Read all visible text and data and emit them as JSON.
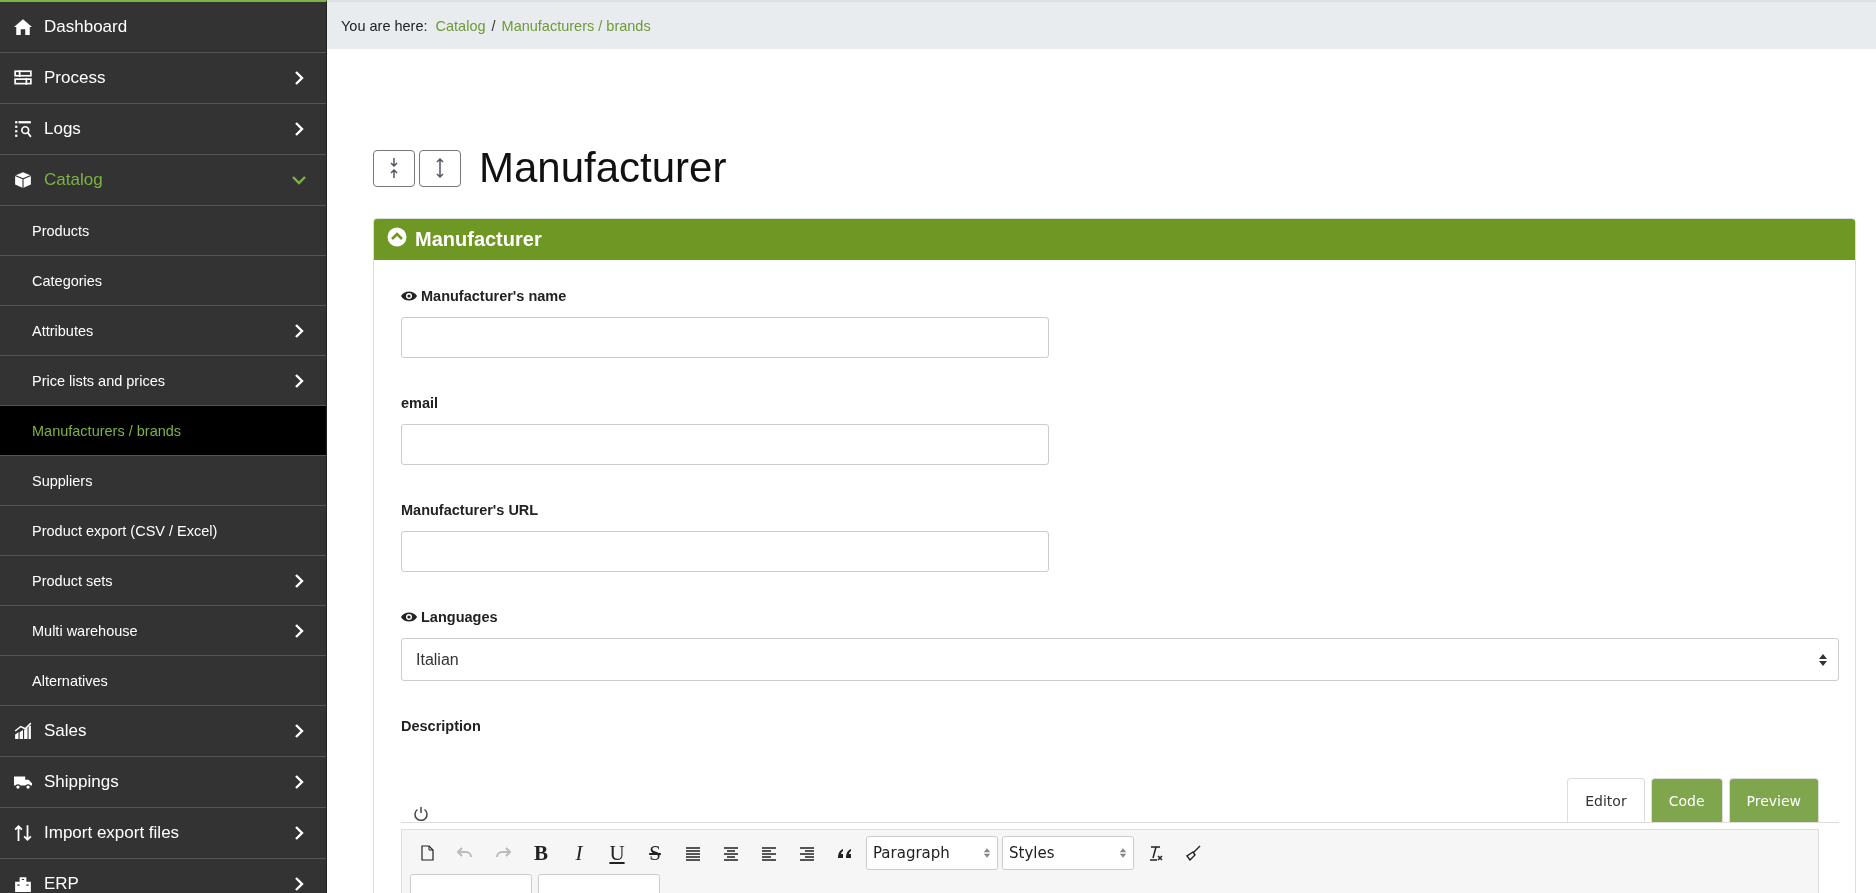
{
  "sidebar": {
    "items": [
      {
        "label": "Dashboard",
        "expandable": false,
        "selected": false
      },
      {
        "label": "Process",
        "expandable": true,
        "expanded": false,
        "selected": false
      },
      {
        "label": "Logs",
        "expandable": true,
        "expanded": false,
        "selected": false
      },
      {
        "label": "Catalog",
        "expandable": true,
        "expanded": true,
        "selected": true,
        "children": [
          {
            "label": "Products",
            "expandable": false,
            "selected": false
          },
          {
            "label": "Categories",
            "expandable": false,
            "selected": false
          },
          {
            "label": "Attributes",
            "expandable": true,
            "selected": false
          },
          {
            "label": "Price lists and prices",
            "expandable": true,
            "selected": false
          },
          {
            "label": "Manufacturers / brands",
            "expandable": false,
            "selected": true
          },
          {
            "label": "Suppliers",
            "expandable": false,
            "selected": false
          },
          {
            "label": "Product export (CSV / Excel)",
            "expandable": false,
            "selected": false
          },
          {
            "label": "Product sets",
            "expandable": true,
            "selected": false
          },
          {
            "label": "Multi warehouse",
            "expandable": true,
            "selected": false
          },
          {
            "label": "Alternatives",
            "expandable": false,
            "selected": false
          }
        ]
      },
      {
        "label": "Sales",
        "expandable": true,
        "expanded": false,
        "selected": false
      },
      {
        "label": "Shippings",
        "expandable": true,
        "expanded": false,
        "selected": false
      },
      {
        "label": "Import export files",
        "expandable": true,
        "expanded": false,
        "selected": false
      },
      {
        "label": "ERP",
        "expandable": true,
        "expanded": false,
        "selected": false
      }
    ]
  },
  "breadcrumb": {
    "prefix": "You are here:",
    "links": [
      "Catalog",
      "Manufacturers / brands"
    ],
    "separator": "/"
  },
  "page_title": "Manufacturer",
  "panel": {
    "title": "Manufacturer",
    "expanded": true,
    "fields": [
      {
        "kind": "text",
        "label": "Manufacturer's name",
        "eye_icon": true
      },
      {
        "kind": "text",
        "label": "email",
        "eye_icon": false
      },
      {
        "kind": "text",
        "label": "Manufacturer's URL",
        "eye_icon": false
      },
      {
        "kind": "select",
        "label": "Languages",
        "eye_icon": true,
        "value": "Italian"
      },
      {
        "kind": "editor",
        "label": "Description",
        "eye_icon": false,
        "tabs": [
          {
            "label": "Editor",
            "selected": true
          },
          {
            "label": "Code",
            "selected": false
          },
          {
            "label": "Preview",
            "selected": false
          }
        ],
        "toolbar": [
          {
            "kind": "new"
          },
          {
            "kind": "undo",
            "disabled": true
          },
          {
            "kind": "redo",
            "disabled": true
          },
          {
            "kind": "glyph",
            "text": "B"
          },
          {
            "kind": "glyph",
            "text": "I"
          },
          {
            "kind": "glyph",
            "text": "U"
          },
          {
            "kind": "glyph",
            "text": "S"
          },
          {
            "kind": "justify"
          },
          {
            "kind": "center"
          },
          {
            "kind": "left"
          },
          {
            "kind": "right"
          },
          {
            "kind": "quote"
          },
          {
            "kind": "select",
            "text": "Paragraph"
          },
          {
            "kind": "select",
            "text": "Styles"
          },
          {
            "kind": "clear"
          },
          {
            "kind": "brush"
          }
        ]
      }
    ]
  }
}
